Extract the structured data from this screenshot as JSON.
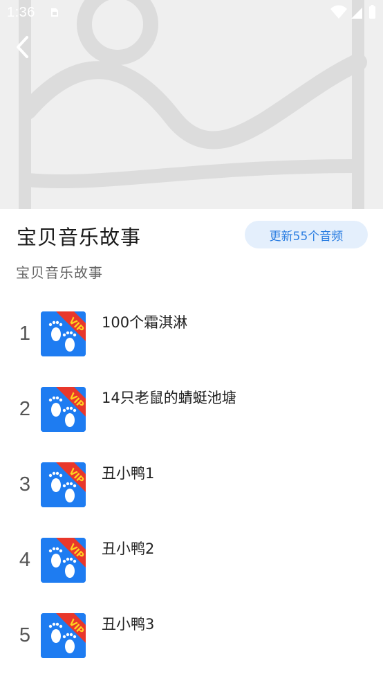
{
  "status_bar": {
    "time": "1:36",
    "icons": [
      "sim-card-icon",
      "wifi-icon",
      "cell-signal-icon",
      "battery-icon"
    ]
  },
  "header": {
    "back_icon": "chevron-left-icon",
    "image": "image-placeholder-icon"
  },
  "album": {
    "title": "宝贝音乐故事",
    "update_label": "更新55个音频",
    "description": "宝贝音乐故事"
  },
  "tracks": [
    {
      "index": "1",
      "name": "100个霜淇淋",
      "badge": "VIP"
    },
    {
      "index": "2",
      "name": "14只老鼠的蜻蜓池塘",
      "badge": "VIP"
    },
    {
      "index": "3",
      "name": "丑小鸭1",
      "badge": "VIP"
    },
    {
      "index": "4",
      "name": "丑小鸭2",
      "badge": "VIP"
    },
    {
      "index": "5",
      "name": "丑小鸭3",
      "badge": "VIP"
    }
  ],
  "colors": {
    "accent": "#2a7de1",
    "pill_bg": "#e4effc",
    "cover_bg": "#1e7cf1",
    "vip_ribbon": "#e8372b",
    "vip_text": "#ffd21f"
  }
}
